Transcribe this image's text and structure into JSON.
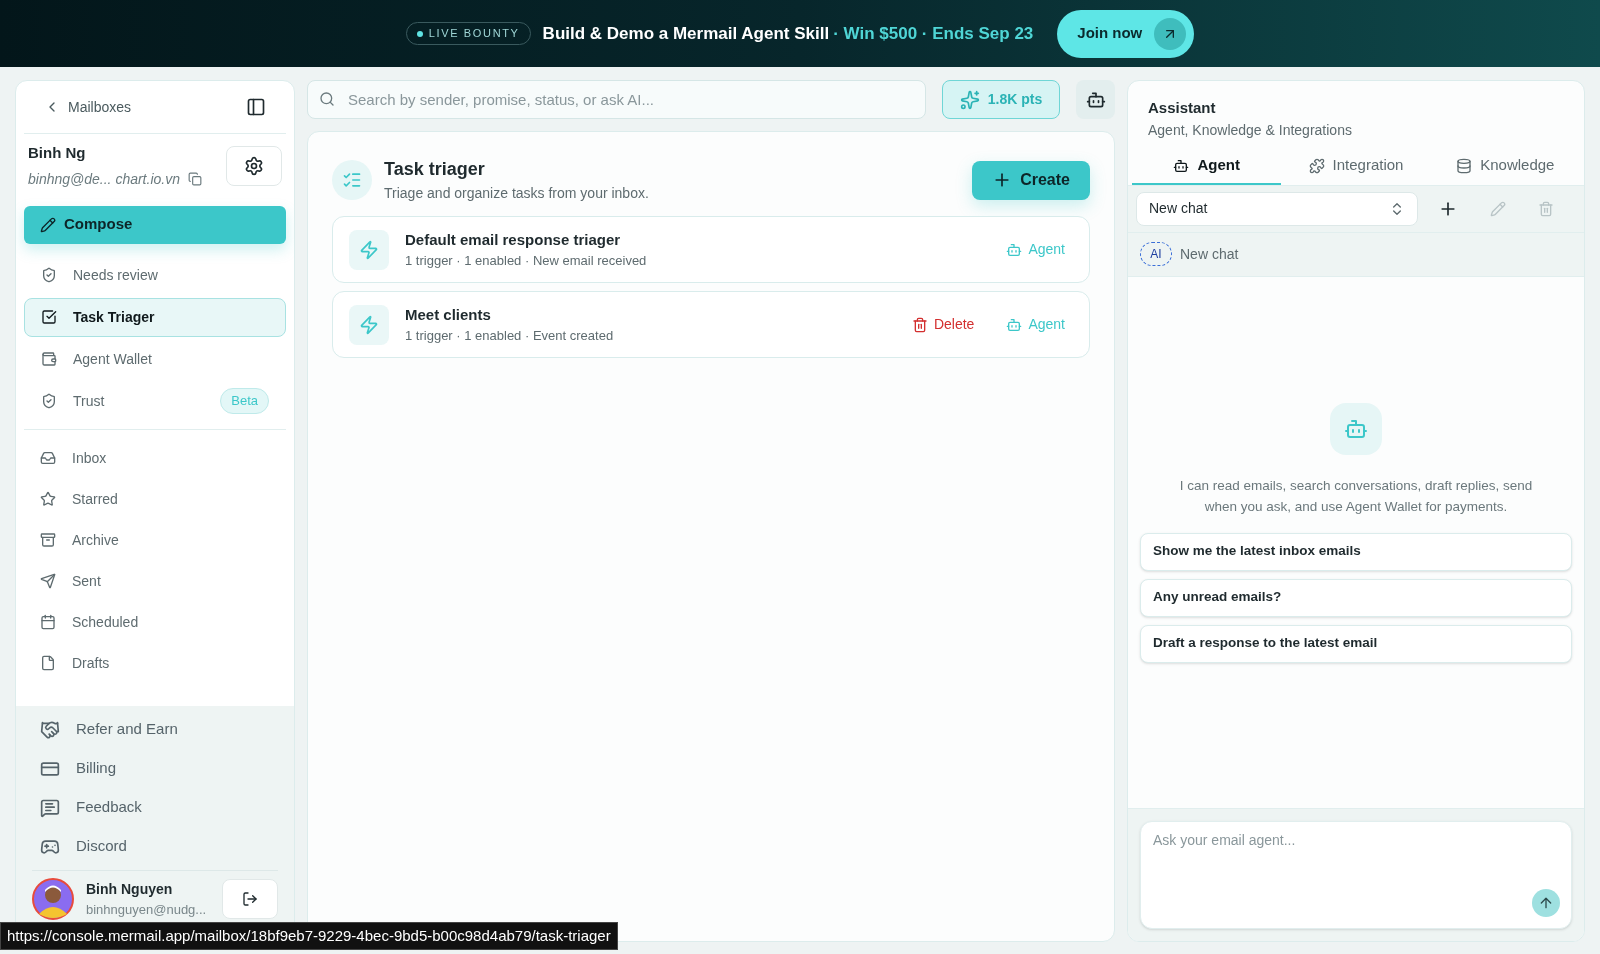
{
  "banner": {
    "badge": "LIVE BOUNTY",
    "title": "Build & Demo a Mermail Agent Skill",
    "highlight": "· Win $500 · Ends Sep 23",
    "button": "Join now"
  },
  "sidebar": {
    "back_label": "Mailboxes",
    "user": {
      "name": "Binh Ng",
      "email": "binhng@de... chart.io.vn"
    },
    "compose": "Compose",
    "nav": [
      {
        "label": "Needs review",
        "selected": false
      },
      {
        "label": "Task Triager",
        "selected": true
      },
      {
        "label": "Agent Wallet",
        "selected": false
      },
      {
        "label": "Trust",
        "selected": false,
        "badge": "Beta"
      }
    ],
    "folders": [
      {
        "label": "Inbox",
        "selected": false
      },
      {
        "label": "Starred",
        "selected": false
      },
      {
        "label": "Archive",
        "selected": false
      },
      {
        "label": "Sent",
        "selected": false
      },
      {
        "label": "Scheduled",
        "selected": false
      },
      {
        "label": "Drafts",
        "selected": false
      }
    ],
    "extras": [
      {
        "label": "Refer and Earn"
      },
      {
        "label": "Billing"
      },
      {
        "label": "Feedback"
      },
      {
        "label": "Discord"
      }
    ],
    "account": {
      "name": "Binh Nguyen",
      "email": "binhnguyen@nudg..."
    }
  },
  "search": {
    "placeholder": "Search by sender, promise, status, or ask AI..."
  },
  "points": "1.8K pts",
  "main": {
    "title": "Task triager",
    "subtitle": "Triage and organize tasks from your inbox.",
    "create": "Create",
    "triggers": [
      {
        "title": "Default email response triager",
        "meta": "1 trigger · 1 enabled · New email received",
        "actions": [
          {
            "kind": "agent",
            "label": "Agent"
          }
        ]
      },
      {
        "title": "Meet clients",
        "meta": "1 trigger · 1 enabled · Event created",
        "actions": [
          {
            "kind": "delete",
            "label": "Delete"
          },
          {
            "kind": "agent",
            "label": "Agent"
          }
        ]
      }
    ]
  },
  "assistant": {
    "title": "Assistant",
    "subtitle": "Agent, Knowledge & Integrations",
    "tabs": [
      {
        "label": "Agent",
        "selected": true
      },
      {
        "label": "Integration",
        "selected": false
      },
      {
        "label": "Knowledge",
        "selected": false
      }
    ],
    "chat_select": "New chat",
    "history": [
      {
        "badge": "AI",
        "label": "New chat"
      }
    ],
    "intro": "I can read emails, search conversations, draft replies, send when you ask, and use Agent Wallet for payments.",
    "suggestions": [
      "Show me the latest inbox emails",
      "Any unread emails?",
      "Draft a response to the latest email"
    ],
    "composer": {
      "placeholder": "Ask your email agent..."
    }
  },
  "status_url": "https://console.mermail.app/mailbox/18bf9eb7-9229-4bec-9bd5-b00c98d4ab79/task-triager"
}
